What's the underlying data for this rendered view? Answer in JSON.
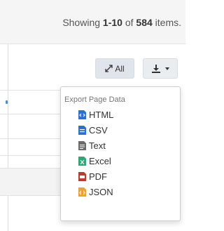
{
  "summary": {
    "prefix": "Showing ",
    "range": "1-10",
    "middle": " of ",
    "total": "584",
    "suffix": " items."
  },
  "toolbar": {
    "all_label": "All",
    "all_icon": "expand-arrows-icon",
    "export_icon": "download-icon",
    "export_caret_icon": "caret-down-icon"
  },
  "export_menu": {
    "header": "Export Page Data",
    "items": [
      {
        "label": "HTML",
        "icon": "file-html-icon",
        "color": "#2e6fd6"
      },
      {
        "label": "CSV",
        "icon": "file-csv-icon",
        "color": "#2e6fd6"
      },
      {
        "label": "Text",
        "icon": "file-text-icon",
        "color": "#6b6b6b"
      },
      {
        "label": "Excel",
        "icon": "file-excel-icon",
        "color": "#2aa876"
      },
      {
        "label": "PDF",
        "icon": "file-pdf-icon",
        "color": "#c0392b"
      },
      {
        "label": "JSON",
        "icon": "file-json-icon",
        "color": "#f0a030"
      }
    ]
  }
}
